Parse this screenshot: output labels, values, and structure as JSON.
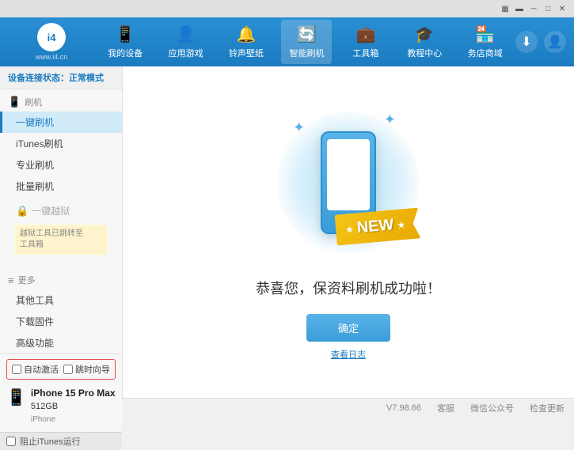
{
  "topbar": {
    "icons": [
      "wifi",
      "battery",
      "minimize",
      "maximize",
      "close"
    ]
  },
  "header": {
    "logo": {
      "symbol": "i4",
      "url": "www.i4.cn"
    },
    "nav": [
      {
        "id": "my-device",
        "icon": "📱",
        "label": "我的设备"
      },
      {
        "id": "apps-games",
        "icon": "👤",
        "label": "应用游戏"
      },
      {
        "id": "ringtones",
        "icon": "🔔",
        "label": "铃声壁纸"
      },
      {
        "id": "smart-flash",
        "icon": "🔄",
        "label": "智能刷机",
        "active": true
      },
      {
        "id": "toolbox",
        "icon": "💼",
        "label": "工具箱"
      },
      {
        "id": "tutorials",
        "icon": "🎓",
        "label": "教程中心"
      },
      {
        "id": "merchant",
        "icon": "🏪",
        "label": "务店商域"
      }
    ],
    "download_icon": "⬇",
    "user_icon": "👤"
  },
  "sidebar": {
    "status_prefix": "设备连接状态：",
    "status_value": "正常模式",
    "sections": [
      {
        "id": "flash",
        "icon": "📱",
        "label": "刷机",
        "items": [
          {
            "id": "one-key-flash",
            "label": "一键刷机",
            "active": true
          },
          {
            "id": "itunes-flash",
            "label": "iTunes刷机"
          },
          {
            "id": "pro-flash",
            "label": "专业刷机"
          },
          {
            "id": "batch-flash",
            "label": "批量刷机"
          }
        ]
      },
      {
        "id": "one-key-jailbreak",
        "icon": "🔓",
        "label": "一键越狱",
        "disabled": true,
        "warning": "越狱工具已跳转至\n工具箱"
      },
      {
        "id": "more",
        "icon": "≡",
        "label": "更多",
        "items": [
          {
            "id": "other-tools",
            "label": "其他工具"
          },
          {
            "id": "download-firmware",
            "label": "下载固件"
          },
          {
            "id": "advanced",
            "label": "高级功能"
          }
        ]
      }
    ],
    "auto_options": [
      {
        "id": "auto-activate",
        "label": "自动激活"
      },
      {
        "id": "timing-guide",
        "label": "跳时向导"
      }
    ],
    "device": {
      "name": "iPhone 15 Pro Max",
      "storage": "512GB",
      "model": "iPhone"
    },
    "itunes_label": "阻止iTunes运行"
  },
  "content": {
    "success_message": "恭喜您，保资料刷机成功啦！",
    "confirm_btn": "确定",
    "log_link": "查看日志"
  },
  "footer": {
    "version": "V7.98.66",
    "links": [
      "客服",
      "微信公众号",
      "检查更新"
    ]
  }
}
